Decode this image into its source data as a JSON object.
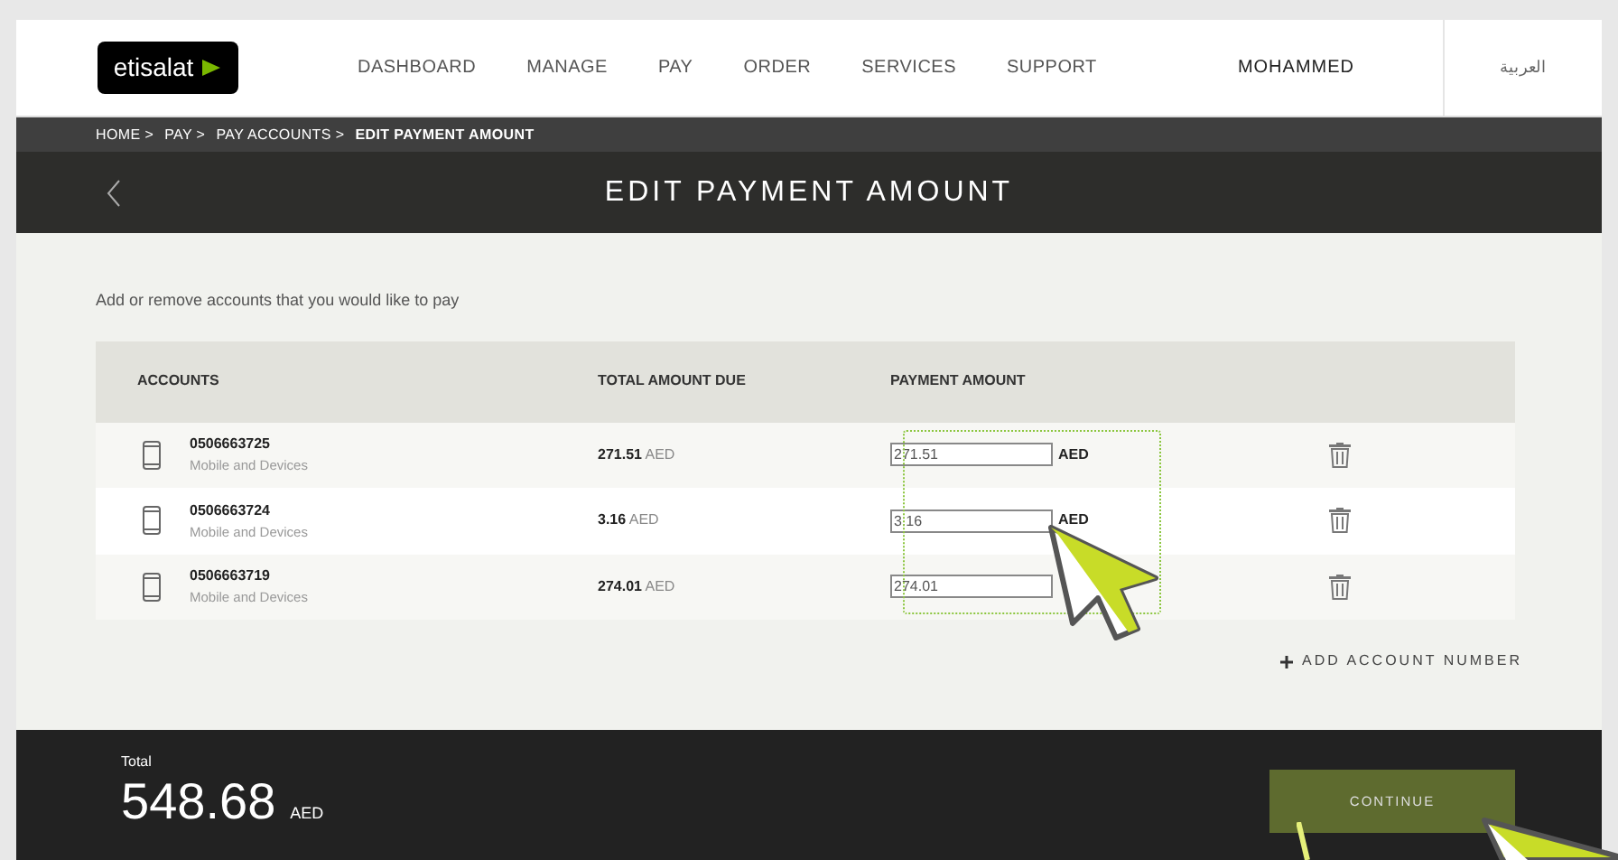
{
  "logo": "etisalat",
  "nav": [
    {
      "label": "DASHBOARD"
    },
    {
      "label": "MANAGE"
    },
    {
      "label": "PAY"
    },
    {
      "label": "ORDER"
    },
    {
      "label": "SERVICES"
    },
    {
      "label": "SUPPORT"
    }
  ],
  "user": "MOHAMMED",
  "language": "العربية",
  "breadcrumb": [
    "HOME >",
    "PAY >",
    "PAY ACCOUNTS >",
    "EDIT PAYMENT AMOUNT"
  ],
  "page_title": "EDIT PAYMENT AMOUNT",
  "intro": "Add or remove accounts that you would like to pay",
  "table": {
    "columns": [
      "ACCOUNTS",
      "TOTAL AMOUNT DUE",
      "PAYMENT AMOUNT"
    ],
    "rows": [
      {
        "number": "0506663725",
        "type": "Mobile and Devices",
        "due": "271.51",
        "due_unit": "AED",
        "payment": "271.51",
        "payment_unit": "AED"
      },
      {
        "number": "0506663724",
        "type": "Mobile and Devices",
        "due": "3.16",
        "due_unit": "AED",
        "payment": "3.16",
        "payment_unit": "AED"
      },
      {
        "number": "0506663719",
        "type": "Mobile and Devices",
        "due": "274.01",
        "due_unit": "AED",
        "payment": "274.01"
      }
    ]
  },
  "add_account": "ADD ACCOUNT NUMBER",
  "total": {
    "label": "Total",
    "amount": "548.68",
    "unit": "AED"
  },
  "continue": "CONTINUE"
}
